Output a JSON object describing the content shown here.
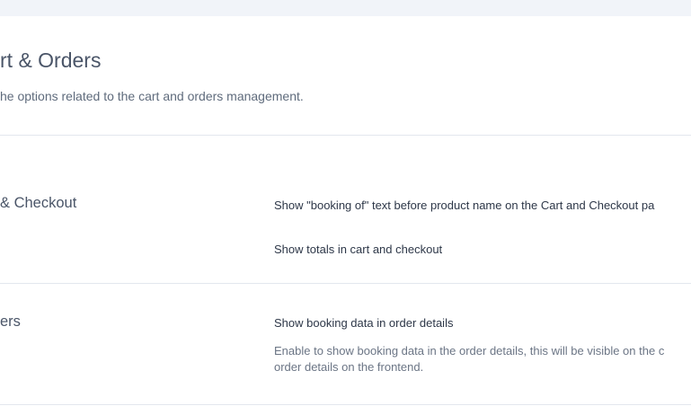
{
  "page": {
    "title": "rt & Orders",
    "subtitle": "he options related to the cart and orders management."
  },
  "sections": [
    {
      "title": "& Checkout",
      "options": [
        {
          "label": "Show \"booking of\" text before product name on the Cart and Checkout pa"
        },
        {
          "label": "Show totals in cart and checkout"
        }
      ]
    },
    {
      "title": "ers",
      "options": [
        {
          "label": "Show booking data in order details",
          "description_line1": "Enable to show booking data in the order details, this will be visible on the c",
          "description_line2": "order details on the frontend."
        }
      ]
    }
  ]
}
